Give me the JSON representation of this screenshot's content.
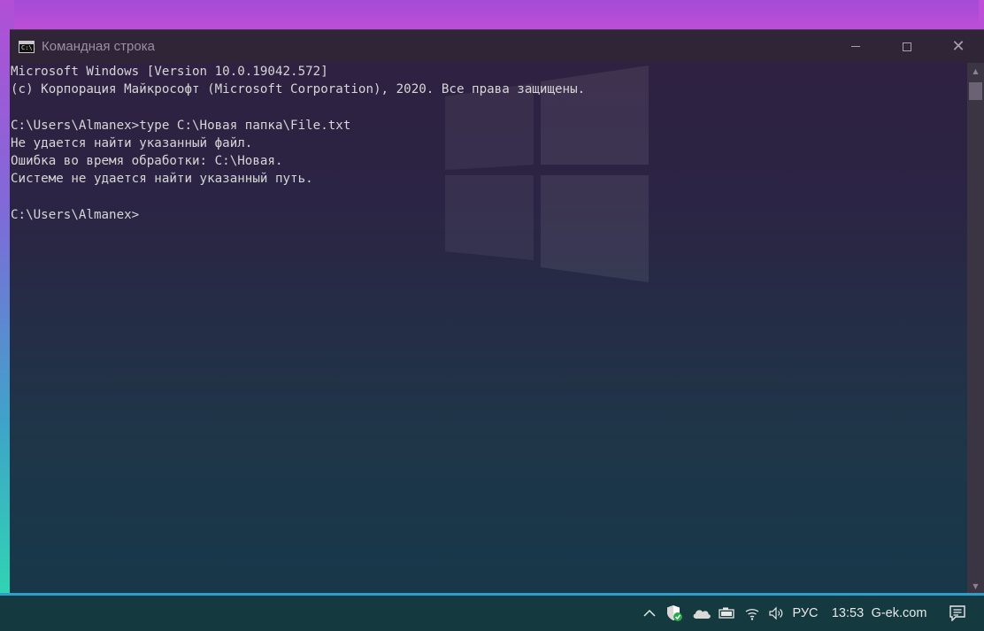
{
  "window": {
    "title": "Командная строка",
    "icon_text": "C:\\."
  },
  "console": {
    "lines": [
      "Microsoft Windows [Version 10.0.19042.572]",
      "(c) Корпорация Майкрософт (Microsoft Corporation), 2020. Все права защищены.",
      "",
      "C:\\Users\\Almanex>type C:\\Новая папка\\File.txt",
      "Не удается найти указанный файл.",
      "Ошибка во время обработки: C:\\Новая.",
      "Системе не удается найти указанный путь.",
      "",
      "C:\\Users\\Almanex>"
    ]
  },
  "taskbar": {
    "language": "РУС",
    "time": "13:53",
    "site": "G-ek.com",
    "icons": [
      "chevron-up-icon",
      "defender-shield-icon",
      "onedrive-cloud-icon",
      "battery-icon",
      "wifi-icon",
      "volume-icon",
      "notification-icon"
    ]
  },
  "colors": {
    "console_text": "#d6d6d6",
    "titlebar": "#2f2537",
    "taskbar": "#14393f",
    "accent": "#2c9fcf"
  }
}
